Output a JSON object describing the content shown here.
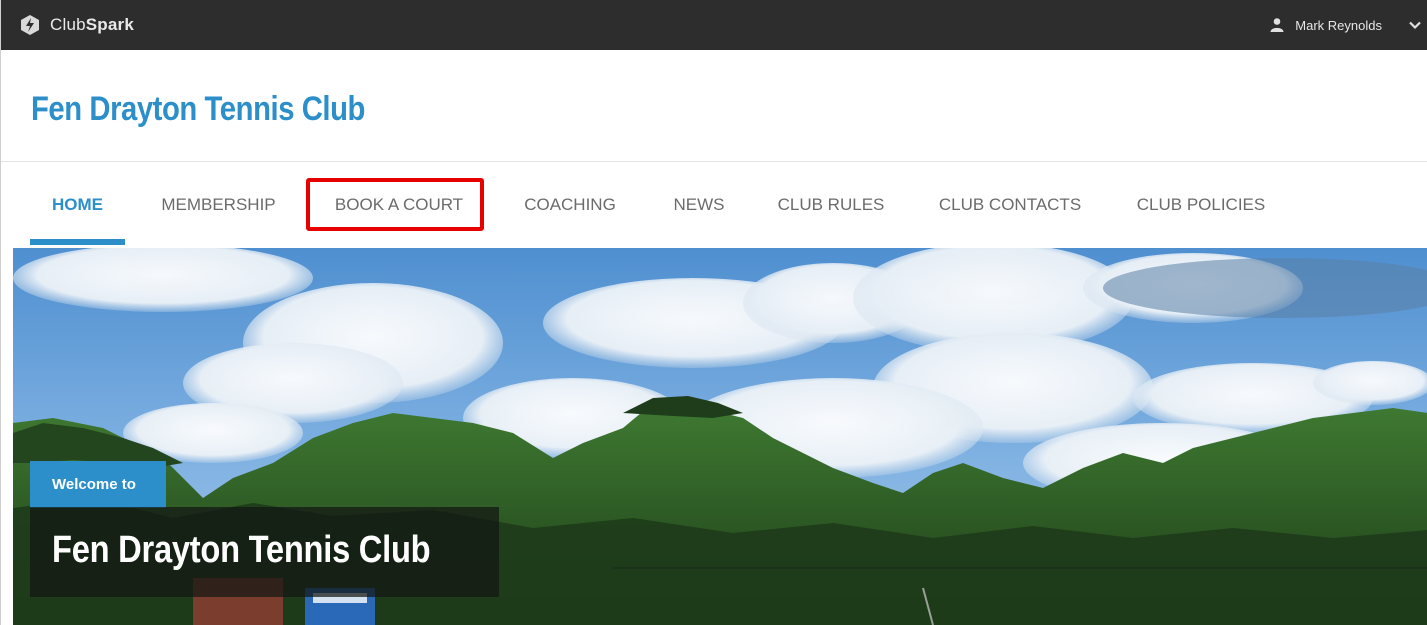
{
  "topbar": {
    "brand_prefix": "Club",
    "brand_suffix": "Spark",
    "logo_icon": "clubspark-logo-icon",
    "user_icon": "user-icon",
    "user_name": "Mark Reynolds",
    "dropdown_icon": "chevron-down-icon"
  },
  "header": {
    "club_name": "Fen Drayton Tennis Club"
  },
  "nav": {
    "items": [
      {
        "label": "HOME",
        "active": true
      },
      {
        "label": "MEMBERSHIP",
        "active": false
      },
      {
        "label": "BOOK A COURT",
        "active": false,
        "highlighted": true
      },
      {
        "label": "COACHING",
        "active": false
      },
      {
        "label": "NEWS",
        "active": false
      },
      {
        "label": "CLUB RULES",
        "active": false
      },
      {
        "label": "CLUB CONTACTS",
        "active": false
      },
      {
        "label": "CLUB POLICIES",
        "active": false
      }
    ],
    "highlight_color": "#e60000"
  },
  "hero": {
    "welcome": "Welcome to",
    "title": "Fen Drayton Tennis Club"
  },
  "colors": {
    "brand_blue": "#2c8fc9",
    "topbar_bg": "#2d2d2d",
    "nav_text": "#6b6b6b"
  }
}
